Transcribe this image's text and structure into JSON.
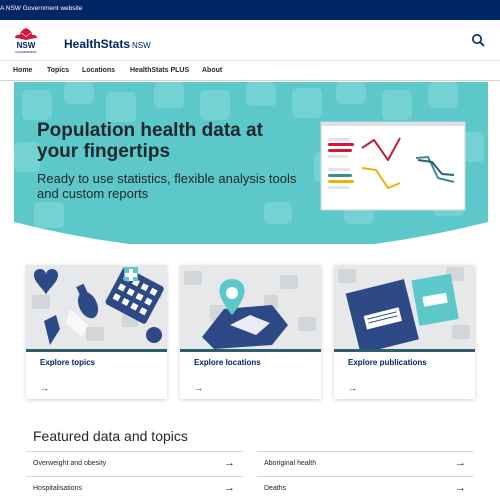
{
  "gov_bar": {
    "text": "A NSW Government website"
  },
  "header": {
    "logo_text": "NSW",
    "logo_sub": "GOVERNMENT",
    "brand_bold": "HealthStats",
    "brand_suffix": "NSW",
    "search_icon": "search-icon"
  },
  "nav": {
    "items": [
      "Home",
      "Topics",
      "Locations",
      "HealthStats PLUS",
      "About"
    ]
  },
  "hero": {
    "title": "Population health data at your fingertips",
    "subtitle": "Ready to use statistics, flexible analysis tools and custom reports"
  },
  "cards": [
    {
      "label": "Explore topics",
      "arrow": "→",
      "icon": "health-topics-illustration"
    },
    {
      "label": "Explore locations",
      "arrow": "→",
      "icon": "map-pin-illustration"
    },
    {
      "label": "Explore publications",
      "arrow": "→",
      "icon": "publications-illustration"
    }
  ],
  "featured": {
    "title": "Featured data and topics",
    "items": [
      {
        "label": "Overweight and obesity",
        "arrow": "→"
      },
      {
        "label": "Aboriginal health",
        "arrow": "→"
      },
      {
        "label": "Hospitalisations",
        "arrow": "→"
      },
      {
        "label": "Deaths",
        "arrow": "→"
      }
    ]
  },
  "colors": {
    "gov_bar": "#002664",
    "hero_bg": "#5cc8c9",
    "card_bar": "#2e5d6b",
    "link": "#002664",
    "logo_red": "#d7153a"
  }
}
